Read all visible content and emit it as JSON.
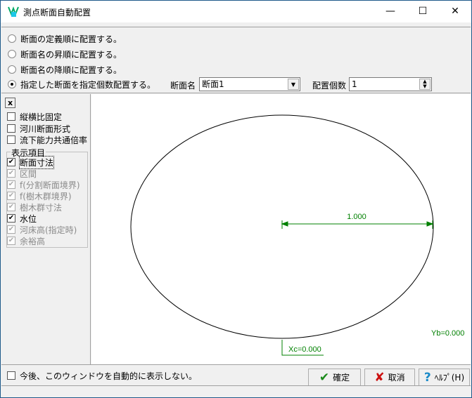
{
  "window": {
    "title": "測点断面自動配置",
    "minimize": "—",
    "maximize": "☐",
    "close": "✕"
  },
  "options": [
    {
      "label": "断面の定義順に配置する。",
      "selected": false
    },
    {
      "label": "断面名の昇順に配置する。",
      "selected": false
    },
    {
      "label": "断面名の降順に配置する。",
      "selected": false
    },
    {
      "label": "指定した断面を指定個数配置する。",
      "selected": true
    }
  ],
  "section_name": {
    "label": "断面名",
    "value": "断面1"
  },
  "count": {
    "label": "配置個数",
    "value": "1"
  },
  "side": {
    "close": "x",
    "checks": [
      {
        "label": "縦横比固定",
        "checked": false
      },
      {
        "label": "河川断面形式",
        "checked": false
      },
      {
        "label": "流下能力共通倍率",
        "checked": false
      }
    ],
    "group_label": "表示項目",
    "items": [
      {
        "label": "断面寸法",
        "checked": true,
        "enabled": true
      },
      {
        "label": "区間",
        "checked": true,
        "enabled": false
      },
      {
        "label": "f(分割断面境界)",
        "checked": true,
        "enabled": false
      },
      {
        "label": "f(樹木群境界)",
        "checked": true,
        "enabled": false
      },
      {
        "label": "樹木群寸法",
        "checked": true,
        "enabled": false
      },
      {
        "label": "水位",
        "checked": true,
        "enabled": true
      },
      {
        "label": "河床高(指定時)",
        "checked": true,
        "enabled": false
      },
      {
        "label": "余裕高",
        "checked": true,
        "enabled": false
      }
    ]
  },
  "drawing": {
    "radius_label": "1.000",
    "xc_label": "Xc=0.000",
    "yb_label": "Yb=0.000",
    "dim_color": "#008000"
  },
  "footer": {
    "dont_show": "今後、このウィンドウを自動的に表示しない。",
    "ok": "確定",
    "cancel": "取消",
    "help": "ﾍﾙﾌﾟ(H)"
  }
}
